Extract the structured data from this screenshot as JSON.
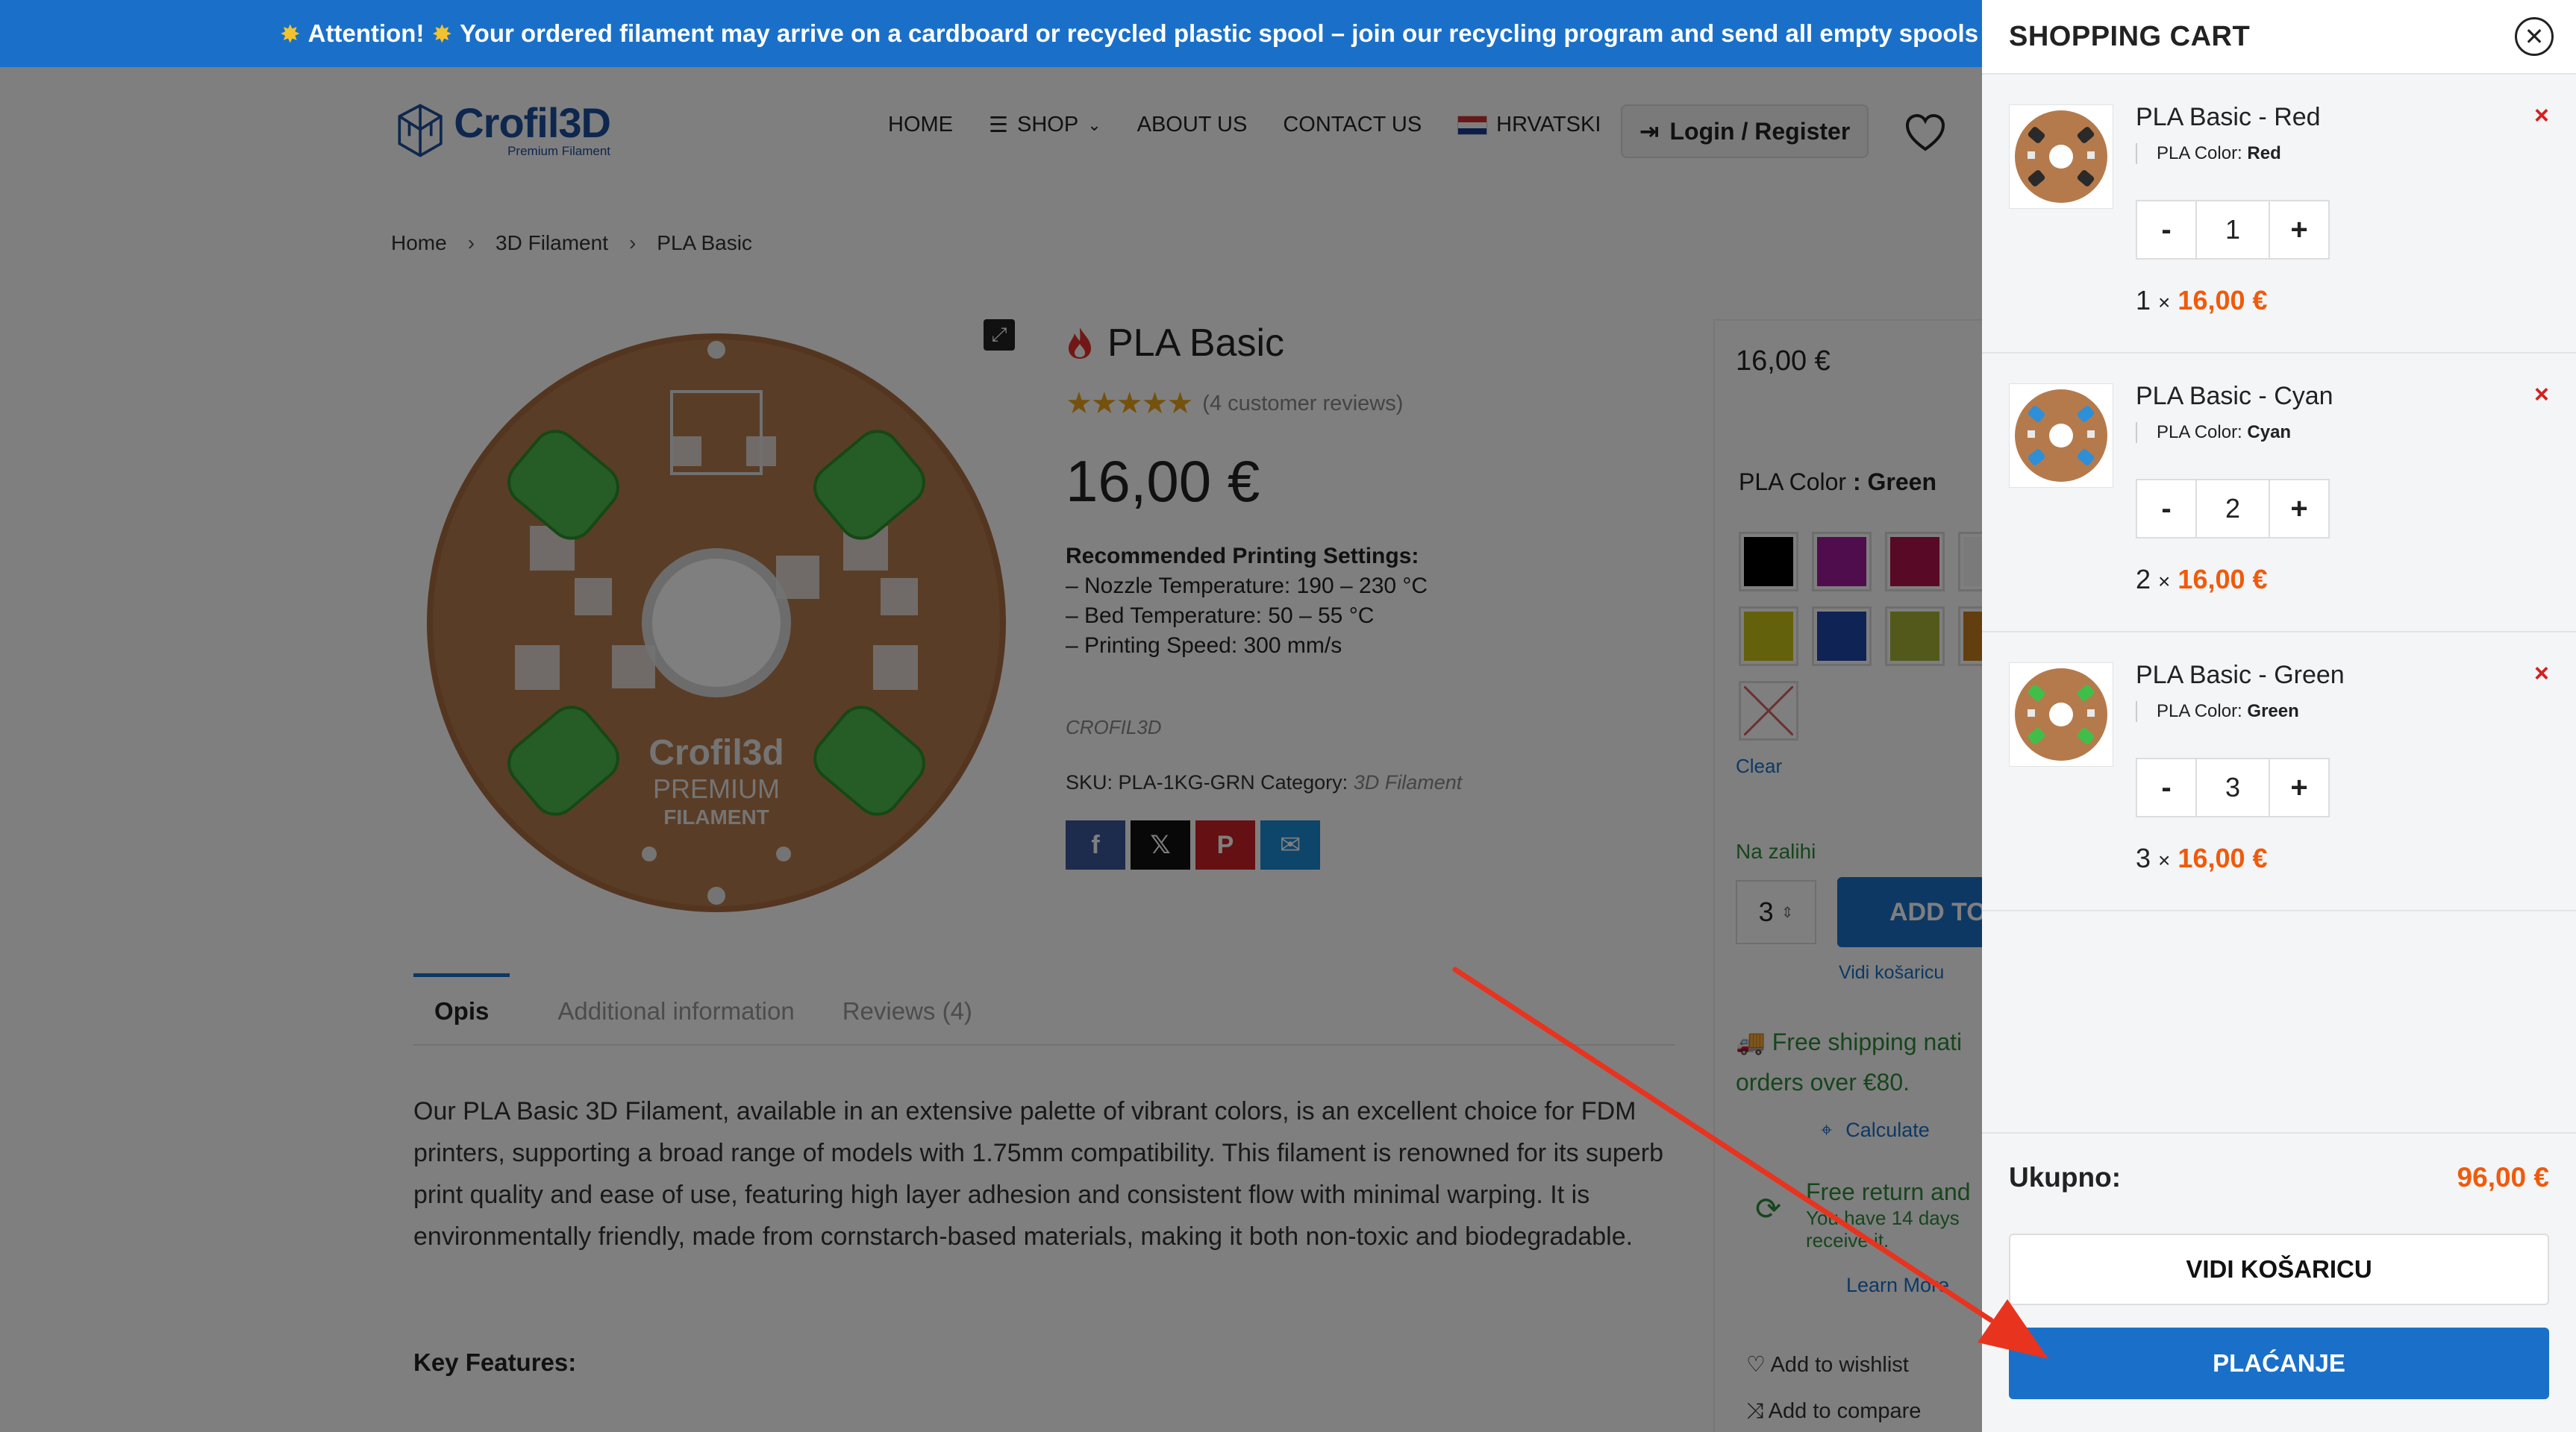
{
  "banner": {
    "icon": "sun-star-icon",
    "lead": "Attention!",
    "text": "Your ordered filament may arrive on a cardboard or recycled plastic spool – join our recycling program and send all empty spools b"
  },
  "logo": {
    "name": "Crofil3D",
    "tagline": "Premium Filament"
  },
  "nav": {
    "home": "HOME",
    "shop": "SHOP",
    "about": "ABOUT US",
    "contact": "CONTACT US",
    "language": "HRVATSKI",
    "login": "Login / Register"
  },
  "breadcrumb": {
    "home": "Home",
    "category": "3D Filament",
    "current": "PLA Basic"
  },
  "product": {
    "title": "PLA Basic",
    "stars": "★★★★★",
    "reviews": "(4 customer reviews)",
    "price": "16,00 €",
    "settings_head": "Recommended Printing Settings:",
    "settings": [
      "– Nozzle Temperature: 190 – 230 °C",
      "– Bed Temperature: 50 – 55 °C",
      "– Printing Speed:  300 mm/s"
    ],
    "brand": "CROFIL3D",
    "sku_label": "SKU:",
    "sku": "PLA-1KG-GRN",
    "category_label": "Category:",
    "category": "3D Filament",
    "spool_text": [
      "Crofil3d",
      "PREMIUM",
      "FILAMENT"
    ]
  },
  "tabs": {
    "desc": "Opis",
    "info": "Additional information",
    "reviews": "Reviews (4)"
  },
  "description": "Our PLA Basic 3D Filament, available in an extensive palette of vibrant colors, is an excellent choice for FDM printers, supporting a broad range of models with 1.75mm compatibility. This filament is renowned for its superb print quality and ease of use, featuring high layer adhesion and consistent flow with minimal warping. It is environmentally friendly, made from cornstarch-based materials, making it both non-toxic and biodegradable.",
  "key_features": "Key Features:",
  "side": {
    "price": "16,00 €",
    "color_label": "PLA Color",
    "color_sep": " : ",
    "color_value": "Green",
    "swatches": [
      "#000000",
      "#a11b9a",
      "#b0134a",
      "#f4f4f4",
      "#c9c21a",
      "#1e47a8",
      "#a6b235",
      "#c77c1f"
    ],
    "clear": "Clear",
    "stock": "Na zalihi",
    "qty": "3",
    "add_to_cart": "ADD TO",
    "view_cart": "Vidi košaricu",
    "shipping": "Free shipping nati orders over €80.",
    "calculate": "Calculate",
    "return_head": "Free return and",
    "return_sub": "You have 14 days receive it.",
    "learn_more": "Learn More",
    "wishlist": "Add to wishlist",
    "compare": "Add to compare"
  },
  "cart": {
    "title": "SHOPPING CART",
    "attr_label": "PLA Color:",
    "items": [
      {
        "name": "PLA Basic - Red",
        "color": "Red",
        "qty": "1",
        "count": "1",
        "price": "16,00 €",
        "accent": "#2a2a2a"
      },
      {
        "name": "PLA Basic - Cyan",
        "color": "Cyan",
        "qty": "2",
        "count": "2",
        "price": "16,00 €",
        "accent": "#2d8fd8"
      },
      {
        "name": "PLA Basic - Green",
        "color": "Green",
        "qty": "3",
        "count": "3",
        "price": "16,00 €",
        "accent": "#3fbf4a"
      }
    ],
    "times": "×",
    "minus": "-",
    "plus": "+",
    "remove": "×",
    "total_label": "Ukupno:",
    "total_value": "96,00 €",
    "view_cart": "VIDI KOŠARICU",
    "checkout": "PLAĆANJE"
  },
  "colors": {
    "brand_blue": "#1a70c9",
    "price_orange": "#f05a0c",
    "remove_red": "#d42020",
    "stock_green": "#2e8b3a",
    "arrow_red": "#e8331f"
  }
}
